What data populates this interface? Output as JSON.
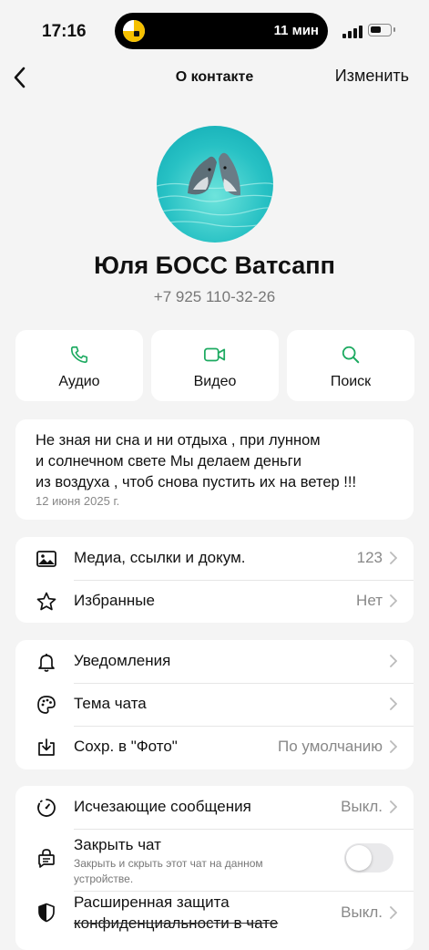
{
  "status": {
    "time": "17:16",
    "activity": "11 мин"
  },
  "nav": {
    "title": "О контакте",
    "edit": "Изменить"
  },
  "contact": {
    "name": "Юля БОСС Ватсапп",
    "phone": "+7 925 110-32-26"
  },
  "actions": [
    {
      "label": "Аудио",
      "icon": "phone-icon"
    },
    {
      "label": "Видео",
      "icon": "video-icon"
    },
    {
      "label": "Поиск",
      "icon": "search-icon"
    }
  ],
  "about": {
    "text": "Не зная ни сна и ни отдыха , при лунном\nи солнечном свете  Мы делаем деньги\nиз воздуха , чтоб снова пустить их на ветер !!!",
    "date": "12 июня 2025 г."
  },
  "group1": [
    {
      "label": "Медиа, ссылки и докум.",
      "value": "123",
      "icon": "image-icon"
    },
    {
      "label": "Избранные",
      "value": "Нет",
      "icon": "star-icon"
    }
  ],
  "group2": [
    {
      "label": "Уведомления",
      "value": "",
      "icon": "bell-icon"
    },
    {
      "label": "Тема чата",
      "value": "",
      "icon": "palette-icon"
    },
    {
      "label": "Сохр. в \"Фото\"",
      "value": "По умолчанию",
      "icon": "download-icon"
    }
  ],
  "group3": {
    "disappearing": {
      "label": "Исчезающие сообщения",
      "value": "Выкл.",
      "icon": "timer-icon"
    },
    "lock": {
      "label": "Закрыть чат",
      "sub": "Закрыть и скрыть этот чат на данном устройстве.",
      "on": false,
      "icon": "chat-lock-icon"
    },
    "privacy": {
      "label1": "Расширенная защита",
      "label2": "конфиденциальности в чате",
      "value": "Выкл.",
      "icon": "shield-icon"
    }
  },
  "colors": {
    "accent": "#1daa61",
    "background": "#f4f4f4"
  }
}
